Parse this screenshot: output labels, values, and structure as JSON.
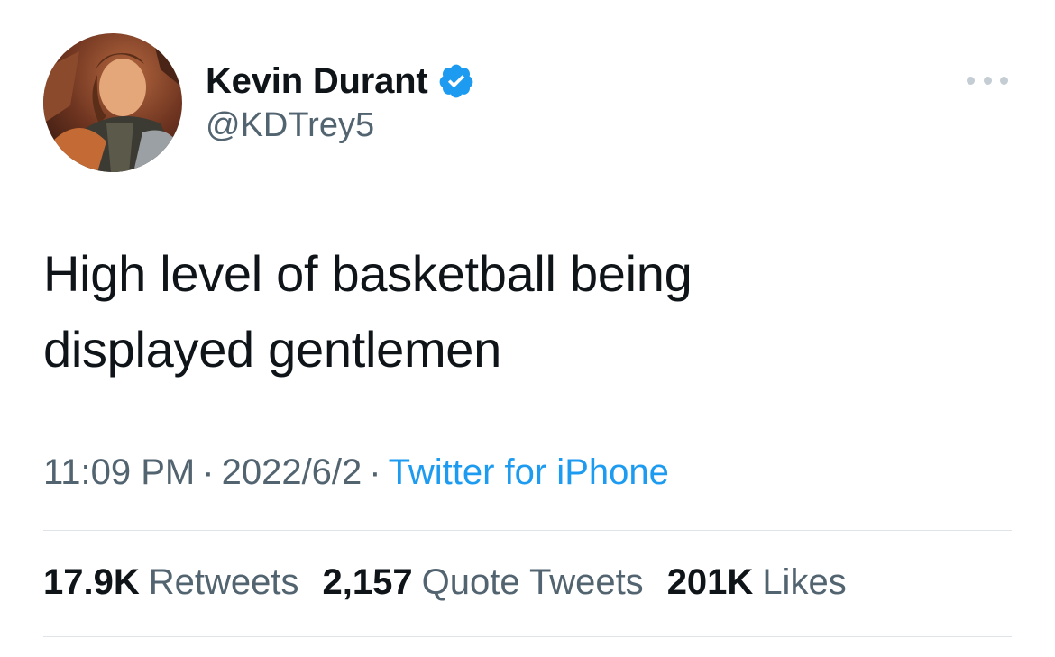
{
  "tweet": {
    "author": {
      "display_name": "Kevin Durant",
      "handle": "@KDTrey5",
      "verified_icon": "verified-badge-icon",
      "avatar": "avatar-illustration"
    },
    "text_line1": "High level of basketball being",
    "text_line2": "displayed gentlemen",
    "time": "11:09 PM",
    "date": "2022/6/2",
    "separator": "·",
    "source": "Twitter for iPhone",
    "stats": {
      "retweets_count": "17.9K",
      "retweets_label": "Retweets",
      "quotes_count": "2,157",
      "quotes_label": "Quote Tweets",
      "likes_count": "201K",
      "likes_label": "Likes"
    },
    "more_icon": "more-options-icon"
  },
  "colors": {
    "primary_text": "#0f1419",
    "secondary_text": "#536471",
    "accent": "#1d9bf0",
    "divider": "#dfe4e8"
  }
}
